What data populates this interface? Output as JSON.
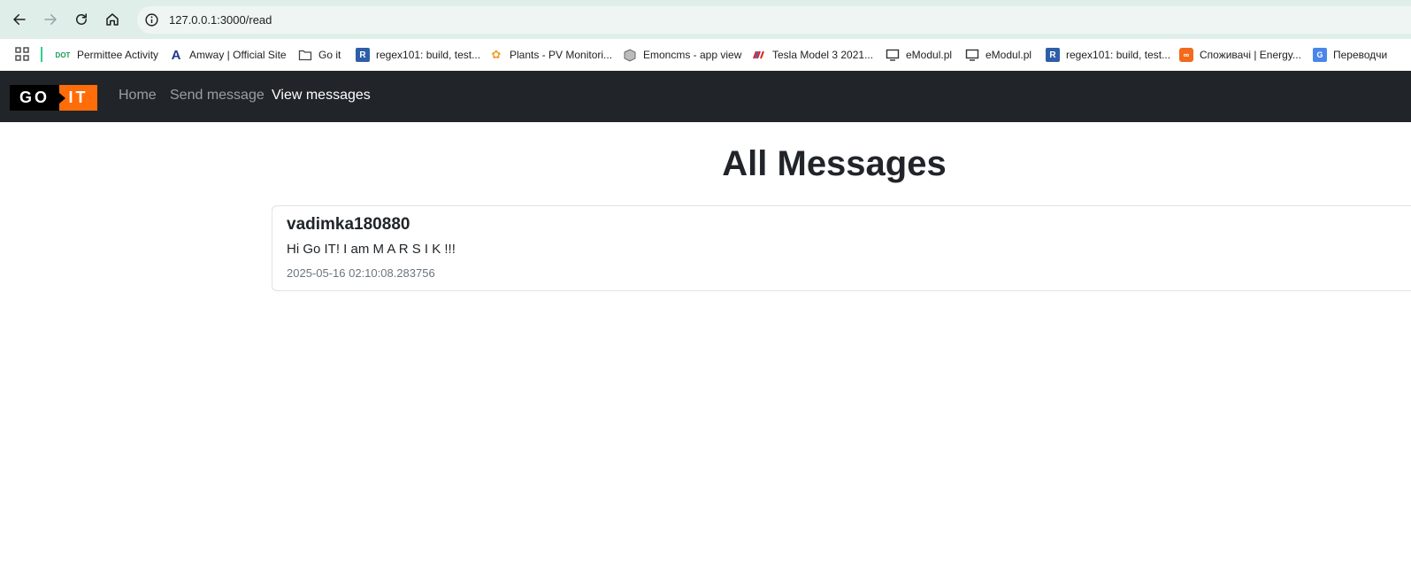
{
  "browser": {
    "url": "127.0.0.1:3000/read",
    "bookmarks": [
      {
        "label": "Permittee Activity",
        "icon": "dot-logo-icon"
      },
      {
        "label": "Amway | Official Site",
        "icon": "amway-icon"
      },
      {
        "label": "Go it",
        "icon": "folder-icon"
      },
      {
        "label": "regex101: build, test...",
        "icon": "regex101-icon"
      },
      {
        "label": "Plants - PV Monitori...",
        "icon": "plants-icon"
      },
      {
        "label": "Emoncms - app view",
        "icon": "emoncms-icon"
      },
      {
        "label": "Tesla Model 3 2021...",
        "icon": "tesla-icon"
      },
      {
        "label": "eModul.pl",
        "icon": "monitor-icon"
      },
      {
        "label": "eModul.pl",
        "icon": "monitor-icon"
      },
      {
        "label": "regex101: build, test...",
        "icon": "regex101-icon"
      },
      {
        "label": "Споживачі | Energy...",
        "icon": "energy-icon"
      },
      {
        "label": "Переводчи",
        "icon": "translate-icon"
      }
    ]
  },
  "navbar": {
    "logo_left": "GO",
    "logo_right": "IT",
    "links": [
      {
        "label": "Home",
        "active": false
      },
      {
        "label": "Send message",
        "active": false
      },
      {
        "label": "View messages",
        "active": true
      }
    ]
  },
  "main": {
    "title": "All Messages",
    "messages": [
      {
        "author": "vadimka180880",
        "text": "Hi Go IT! I am M A R S I K !!!",
        "timestamp": "2025-05-16 02:10:08.283756"
      }
    ]
  },
  "colors": {
    "navbar_bg": "#212529",
    "brand_orange": "#ff6c0a",
    "chrome_bg": "#dfeee9"
  }
}
